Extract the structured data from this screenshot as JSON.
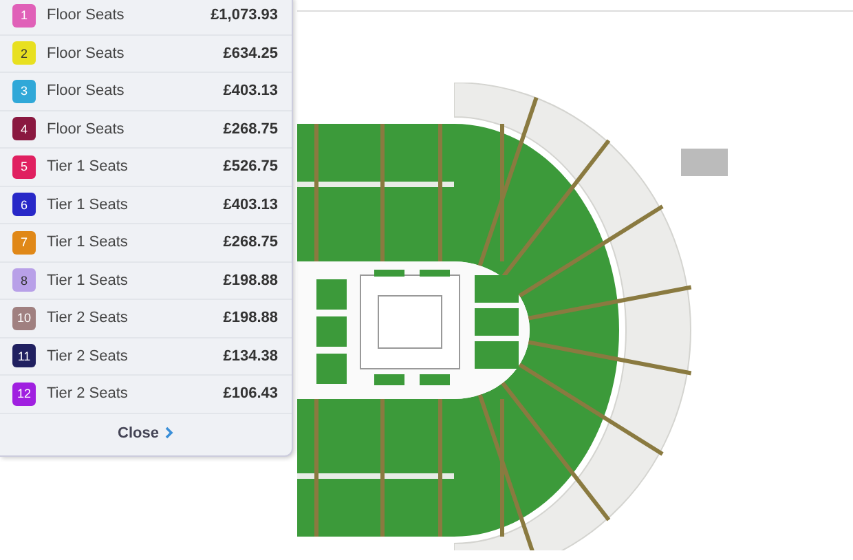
{
  "price_levels": [
    {
      "number": "1",
      "name": "Floor Seats",
      "price": "£1,073.93",
      "color": "#e060b8"
    },
    {
      "number": "2",
      "name": "Floor Seats",
      "price": "£634.25",
      "color": "#e8e020"
    },
    {
      "number": "3",
      "name": "Floor Seats",
      "price": "£403.13",
      "color": "#30a8d8"
    },
    {
      "number": "4",
      "name": "Floor Seats",
      "price": "£268.75",
      "color": "#8a1840"
    },
    {
      "number": "5",
      "name": "Tier 1 Seats",
      "price": "£526.75",
      "color": "#e02060"
    },
    {
      "number": "6",
      "name": "Tier 1 Seats",
      "price": "£403.13",
      "color": "#2828c8"
    },
    {
      "number": "7",
      "name": "Tier 1 Seats",
      "price": "£268.75",
      "color": "#e08818"
    },
    {
      "number": "8",
      "name": "Tier 1 Seats",
      "price": "£198.88",
      "color": "#b8a0e8"
    },
    {
      "number": "10",
      "name": "Tier 2 Seats",
      "price": "£198.88",
      "color": "#a08080"
    },
    {
      "number": "11",
      "name": "Tier 2 Seats",
      "price": "£134.38",
      "color": "#202060"
    },
    {
      "number": "12",
      "name": "Tier 2 Seats",
      "price": "£106.43",
      "color": "#a020e0"
    }
  ],
  "close_button": {
    "label": "Close"
  }
}
